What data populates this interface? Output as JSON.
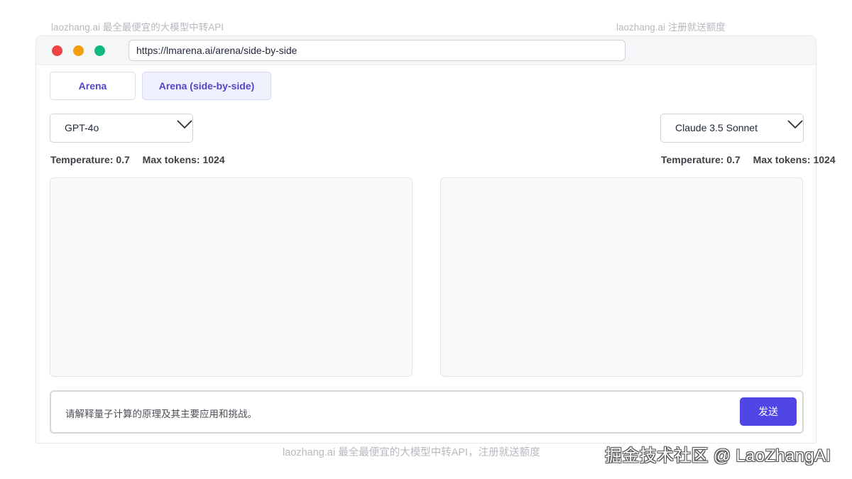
{
  "watermarks": {
    "top_left": "laozhang.ai 最全最便宜的大模型中转API",
    "top_right": "laozhang.ai 注册就送额度",
    "bottom": "laozhang.ai 最全最便宜的大模型中转API，注册就送额度",
    "juejin": "掘金技术社区 @ LaoZhangAI"
  },
  "browser": {
    "url": "https://lmarena.ai/arena/side-by-side"
  },
  "tabs": [
    {
      "label": "Arena",
      "active": false
    },
    {
      "label": "Arena (side-by-side)",
      "active": true
    }
  ],
  "models": {
    "left": {
      "selected": "GPT-4o",
      "temperature": "Temperature: 0.7",
      "max_tokens": "Max tokens: 1024"
    },
    "right": {
      "selected": "Claude 3.5 Sonnet",
      "temperature": "Temperature: 0.7",
      "max_tokens": "Max tokens: 1024"
    }
  },
  "input": {
    "value": "请解释量子计算的原理及其主要应用和挑战。",
    "send_label": "发送"
  },
  "colors": {
    "accent": "#4f46e5",
    "tab_text": "#4f46c8",
    "close_dot": "#ef4444",
    "minimize_dot": "#f59e0b",
    "maximize_dot": "#10b981"
  }
}
